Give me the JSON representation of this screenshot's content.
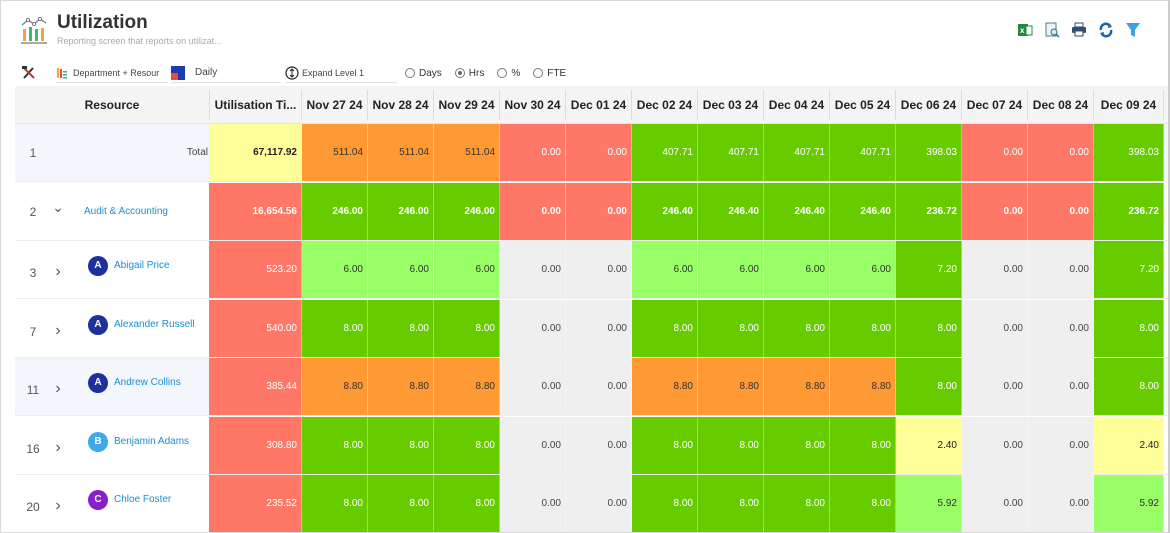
{
  "header": {
    "title": "Utilization",
    "subtitle": "Reporting screen that reports on utilizat...",
    "icons": [
      "excel-export-icon",
      "preview-icon",
      "print-icon",
      "refresh-icon",
      "filter-icon"
    ]
  },
  "toolbar": {
    "grouping": "Department + Resour",
    "period": "Daily",
    "expand": "Expand Level 1",
    "units": [
      {
        "label": "Days",
        "selected": false
      },
      {
        "label": "Hrs",
        "selected": true
      },
      {
        "label": "%",
        "selected": false
      },
      {
        "label": "FTE",
        "selected": false
      }
    ]
  },
  "colors": {
    "yellow": "#ffff99",
    "orange": "#ff9933",
    "red": "#ff7766",
    "green": "#66cc00",
    "lightgreen": "#99ff66",
    "grey": "#efefef",
    "link": "#1a8fd0"
  },
  "grid": {
    "columns": [
      "Resource",
      "Utilisation Ti...",
      "Nov 27 24",
      "Nov 28 24",
      "Nov 29 24",
      "Nov 30 24",
      "Dec 01 24",
      "Dec 02 24",
      "Dec 03 24",
      "Dec 04 24",
      "Dec 05 24",
      "Dec 06 24",
      "Dec 07 24",
      "Dec 08 24",
      "Dec 09 24"
    ],
    "rows": [
      {
        "num": "1",
        "type": "total",
        "label": "Total",
        "cells": [
          {
            "v": "67,117.92",
            "c": "yellow"
          },
          {
            "v": "511.04",
            "c": "orange"
          },
          {
            "v": "511.04",
            "c": "orange"
          },
          {
            "v": "511.04",
            "c": "orange"
          },
          {
            "v": "0.00",
            "c": "red"
          },
          {
            "v": "0.00",
            "c": "red"
          },
          {
            "v": "407.71",
            "c": "green"
          },
          {
            "v": "407.71",
            "c": "green"
          },
          {
            "v": "407.71",
            "c": "green"
          },
          {
            "v": "407.71",
            "c": "green"
          },
          {
            "v": "398.03",
            "c": "green"
          },
          {
            "v": "0.00",
            "c": "red"
          },
          {
            "v": "0.00",
            "c": "red"
          },
          {
            "v": "398.03",
            "c": "green"
          }
        ]
      },
      {
        "num": "2",
        "type": "group",
        "label": "Audit & Accounting",
        "expanded": true,
        "cells": [
          {
            "v": "16,654.56",
            "c": "red"
          },
          {
            "v": "246.00",
            "c": "green"
          },
          {
            "v": "246.00",
            "c": "green"
          },
          {
            "v": "246.00",
            "c": "green"
          },
          {
            "v": "0.00",
            "c": "red"
          },
          {
            "v": "0.00",
            "c": "red"
          },
          {
            "v": "246.40",
            "c": "green"
          },
          {
            "v": "246.40",
            "c": "green"
          },
          {
            "v": "246.40",
            "c": "green"
          },
          {
            "v": "246.40",
            "c": "green"
          },
          {
            "v": "236.72",
            "c": "green"
          },
          {
            "v": "0.00",
            "c": "red"
          },
          {
            "v": "0.00",
            "c": "red"
          },
          {
            "v": "236.72",
            "c": "green"
          }
        ]
      },
      {
        "num": "3",
        "type": "person",
        "label": "Abigail Price",
        "initial": "A",
        "avatar_color": "#1e2f9e",
        "cells": [
          {
            "v": "523.20",
            "c": "red"
          },
          {
            "v": "6.00",
            "c": "lightgreen"
          },
          {
            "v": "6.00",
            "c": "lightgreen"
          },
          {
            "v": "6.00",
            "c": "lightgreen"
          },
          {
            "v": "0.00",
            "c": "grey"
          },
          {
            "v": "0.00",
            "c": "grey"
          },
          {
            "v": "6.00",
            "c": "lightgreen"
          },
          {
            "v": "6.00",
            "c": "lightgreen"
          },
          {
            "v": "6.00",
            "c": "lightgreen"
          },
          {
            "v": "6.00",
            "c": "lightgreen"
          },
          {
            "v": "7.20",
            "c": "green"
          },
          {
            "v": "0.00",
            "c": "grey"
          },
          {
            "v": "0.00",
            "c": "grey"
          },
          {
            "v": "7.20",
            "c": "green"
          }
        ]
      },
      {
        "num": "7",
        "type": "person",
        "label": "Alexander Russell",
        "initial": "A",
        "avatar_color": "#1e2f9e",
        "cells": [
          {
            "v": "540.00",
            "c": "red"
          },
          {
            "v": "8.00",
            "c": "green"
          },
          {
            "v": "8.00",
            "c": "green"
          },
          {
            "v": "8.00",
            "c": "green"
          },
          {
            "v": "0.00",
            "c": "grey"
          },
          {
            "v": "0.00",
            "c": "grey"
          },
          {
            "v": "8.00",
            "c": "green"
          },
          {
            "v": "8.00",
            "c": "green"
          },
          {
            "v": "8.00",
            "c": "green"
          },
          {
            "v": "8.00",
            "c": "green"
          },
          {
            "v": "8.00",
            "c": "green"
          },
          {
            "v": "0.00",
            "c": "grey"
          },
          {
            "v": "0.00",
            "c": "grey"
          },
          {
            "v": "8.00",
            "c": "green"
          }
        ]
      },
      {
        "num": "11",
        "type": "person",
        "label": "Andrew Collins",
        "initial": "A",
        "avatar_color": "#1e2f9e",
        "alt": true,
        "cells": [
          {
            "v": "385.44",
            "c": "red"
          },
          {
            "v": "8.80",
            "c": "orange"
          },
          {
            "v": "8.80",
            "c": "orange"
          },
          {
            "v": "8.80",
            "c": "orange"
          },
          {
            "v": "0.00",
            "c": "grey"
          },
          {
            "v": "0.00",
            "c": "grey"
          },
          {
            "v": "8.80",
            "c": "orange"
          },
          {
            "v": "8.80",
            "c": "orange"
          },
          {
            "v": "8.80",
            "c": "orange"
          },
          {
            "v": "8.80",
            "c": "orange"
          },
          {
            "v": "8.00",
            "c": "green"
          },
          {
            "v": "0.00",
            "c": "grey"
          },
          {
            "v": "0.00",
            "c": "grey"
          },
          {
            "v": "8.00",
            "c": "green"
          }
        ]
      },
      {
        "num": "16",
        "type": "person",
        "label": "Benjamin Adams",
        "initial": "B",
        "avatar_color": "#3fa9e8",
        "cells": [
          {
            "v": "308.80",
            "c": "red"
          },
          {
            "v": "8.00",
            "c": "green"
          },
          {
            "v": "8.00",
            "c": "green"
          },
          {
            "v": "8.00",
            "c": "green"
          },
          {
            "v": "0.00",
            "c": "grey"
          },
          {
            "v": "0.00",
            "c": "grey"
          },
          {
            "v": "8.00",
            "c": "green"
          },
          {
            "v": "8.00",
            "c": "green"
          },
          {
            "v": "8.00",
            "c": "green"
          },
          {
            "v": "8.00",
            "c": "green"
          },
          {
            "v": "2.40",
            "c": "yellow"
          },
          {
            "v": "0.00",
            "c": "grey"
          },
          {
            "v": "0.00",
            "c": "grey"
          },
          {
            "v": "2.40",
            "c": "yellow"
          }
        ]
      },
      {
        "num": "20",
        "type": "person",
        "label": "Chloe Foster",
        "initial": "C",
        "avatar_color": "#8a1fc9",
        "cells": [
          {
            "v": "235.52",
            "c": "red"
          },
          {
            "v": "8.00",
            "c": "green"
          },
          {
            "v": "8.00",
            "c": "green"
          },
          {
            "v": "8.00",
            "c": "green"
          },
          {
            "v": "0.00",
            "c": "grey"
          },
          {
            "v": "0.00",
            "c": "grey"
          },
          {
            "v": "8.00",
            "c": "green"
          },
          {
            "v": "8.00",
            "c": "green"
          },
          {
            "v": "8.00",
            "c": "green"
          },
          {
            "v": "8.00",
            "c": "green"
          },
          {
            "v": "5.92",
            "c": "lightgreen"
          },
          {
            "v": "0.00",
            "c": "grey"
          },
          {
            "v": "0.00",
            "c": "grey"
          },
          {
            "v": "5.92",
            "c": "lightgreen"
          }
        ]
      }
    ]
  }
}
